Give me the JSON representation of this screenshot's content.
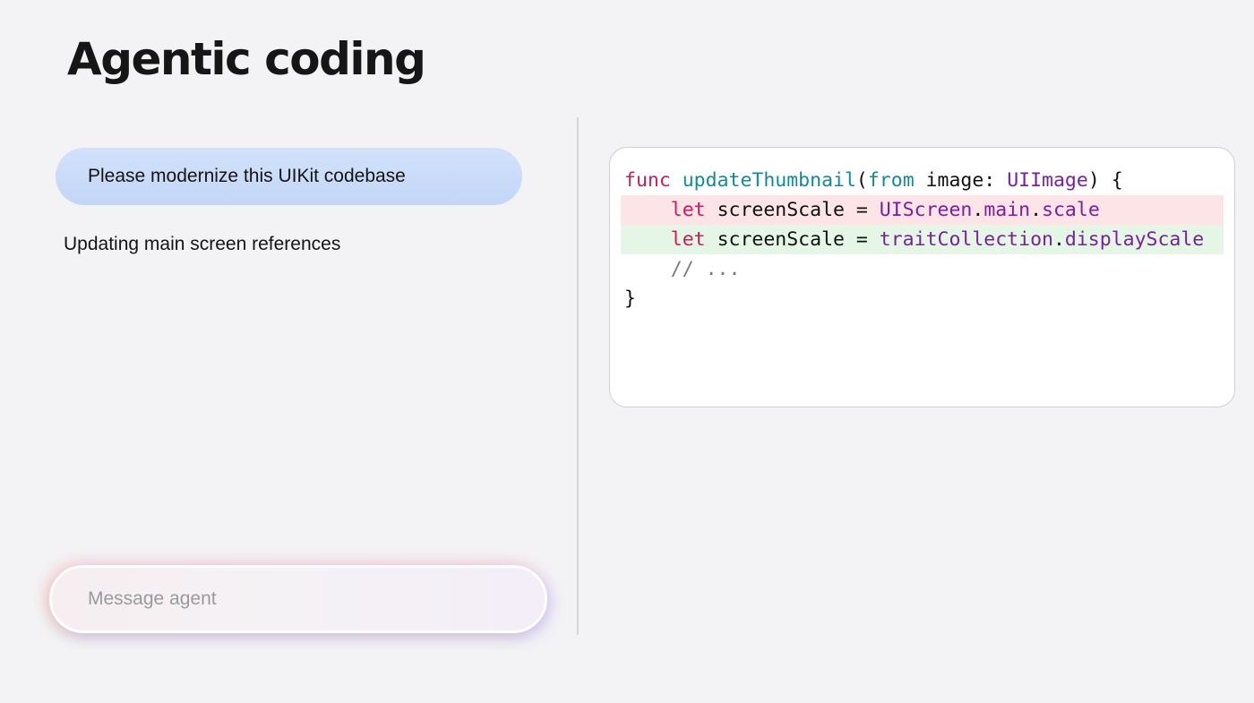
{
  "page": {
    "title": "Agentic coding"
  },
  "chat": {
    "user_message": "Please modernize this UIKit codebase",
    "agent_status": "Updating main screen references",
    "input": {
      "placeholder": "Message agent",
      "value": ""
    }
  },
  "code": {
    "lines": [
      {
        "type": "normal",
        "tokens": [
          {
            "t": "func",
            "c": "kw"
          },
          {
            "t": " "
          },
          {
            "t": "updateThumbnail",
            "c": "fn"
          },
          {
            "t": "("
          },
          {
            "t": "from",
            "c": "fn"
          },
          {
            "t": " image: "
          },
          {
            "t": "UIImage",
            "c": "ty"
          },
          {
            "t": ") {"
          }
        ]
      },
      {
        "type": "removed",
        "tokens": [
          {
            "t": "    "
          },
          {
            "t": "let",
            "c": "kw"
          },
          {
            "t": " screenScale = "
          },
          {
            "t": "UIScreen",
            "c": "ty"
          },
          {
            "t": "."
          },
          {
            "t": "main",
            "c": "ty"
          },
          {
            "t": "."
          },
          {
            "t": "scale",
            "c": "ty"
          }
        ]
      },
      {
        "type": "added",
        "tokens": [
          {
            "t": "    "
          },
          {
            "t": "let",
            "c": "kw"
          },
          {
            "t": " screenScale = "
          },
          {
            "t": "traitCollection",
            "c": "ty"
          },
          {
            "t": "."
          },
          {
            "t": "displayScale",
            "c": "ty"
          }
        ]
      },
      {
        "type": "normal",
        "tokens": [
          {
            "t": "    "
          },
          {
            "t": "// ...",
            "c": "cm"
          }
        ]
      },
      {
        "type": "normal",
        "tokens": [
          {
            "t": "}"
          }
        ]
      }
    ]
  },
  "colors": {
    "background": "#f3f3f5",
    "user_bubble": "#c8daf8",
    "removed_line": "#fde4e6",
    "added_line": "#e5f6e6",
    "keyword": "#d01b5c",
    "function": "#0e8c9c",
    "type": "#7b1fa2"
  }
}
